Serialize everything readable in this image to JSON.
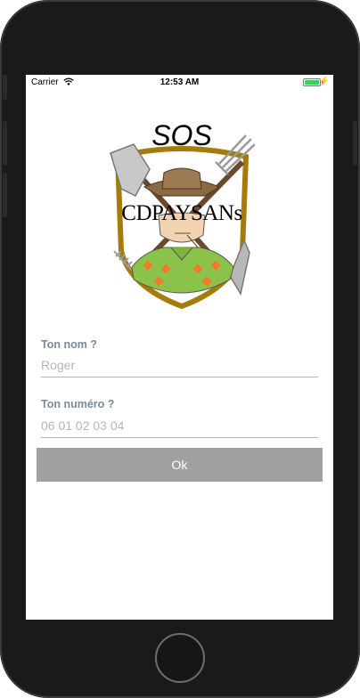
{
  "status_bar": {
    "carrier": "Carrier",
    "time": "12:53 AM",
    "battery_color": "#35d35a"
  },
  "logo": {
    "title": "SOS",
    "banner": "CDPAYSANs"
  },
  "form": {
    "name_label": "Ton nom ?",
    "name_placeholder": "Roger",
    "number_label": "Ton numéro ?",
    "number_placeholder": "06 01 02 03 04",
    "submit_label": "Ok"
  },
  "colors": {
    "button_bg": "#a0a0a0",
    "label": "#7b8a94",
    "shield_border": "#a57c0a"
  }
}
